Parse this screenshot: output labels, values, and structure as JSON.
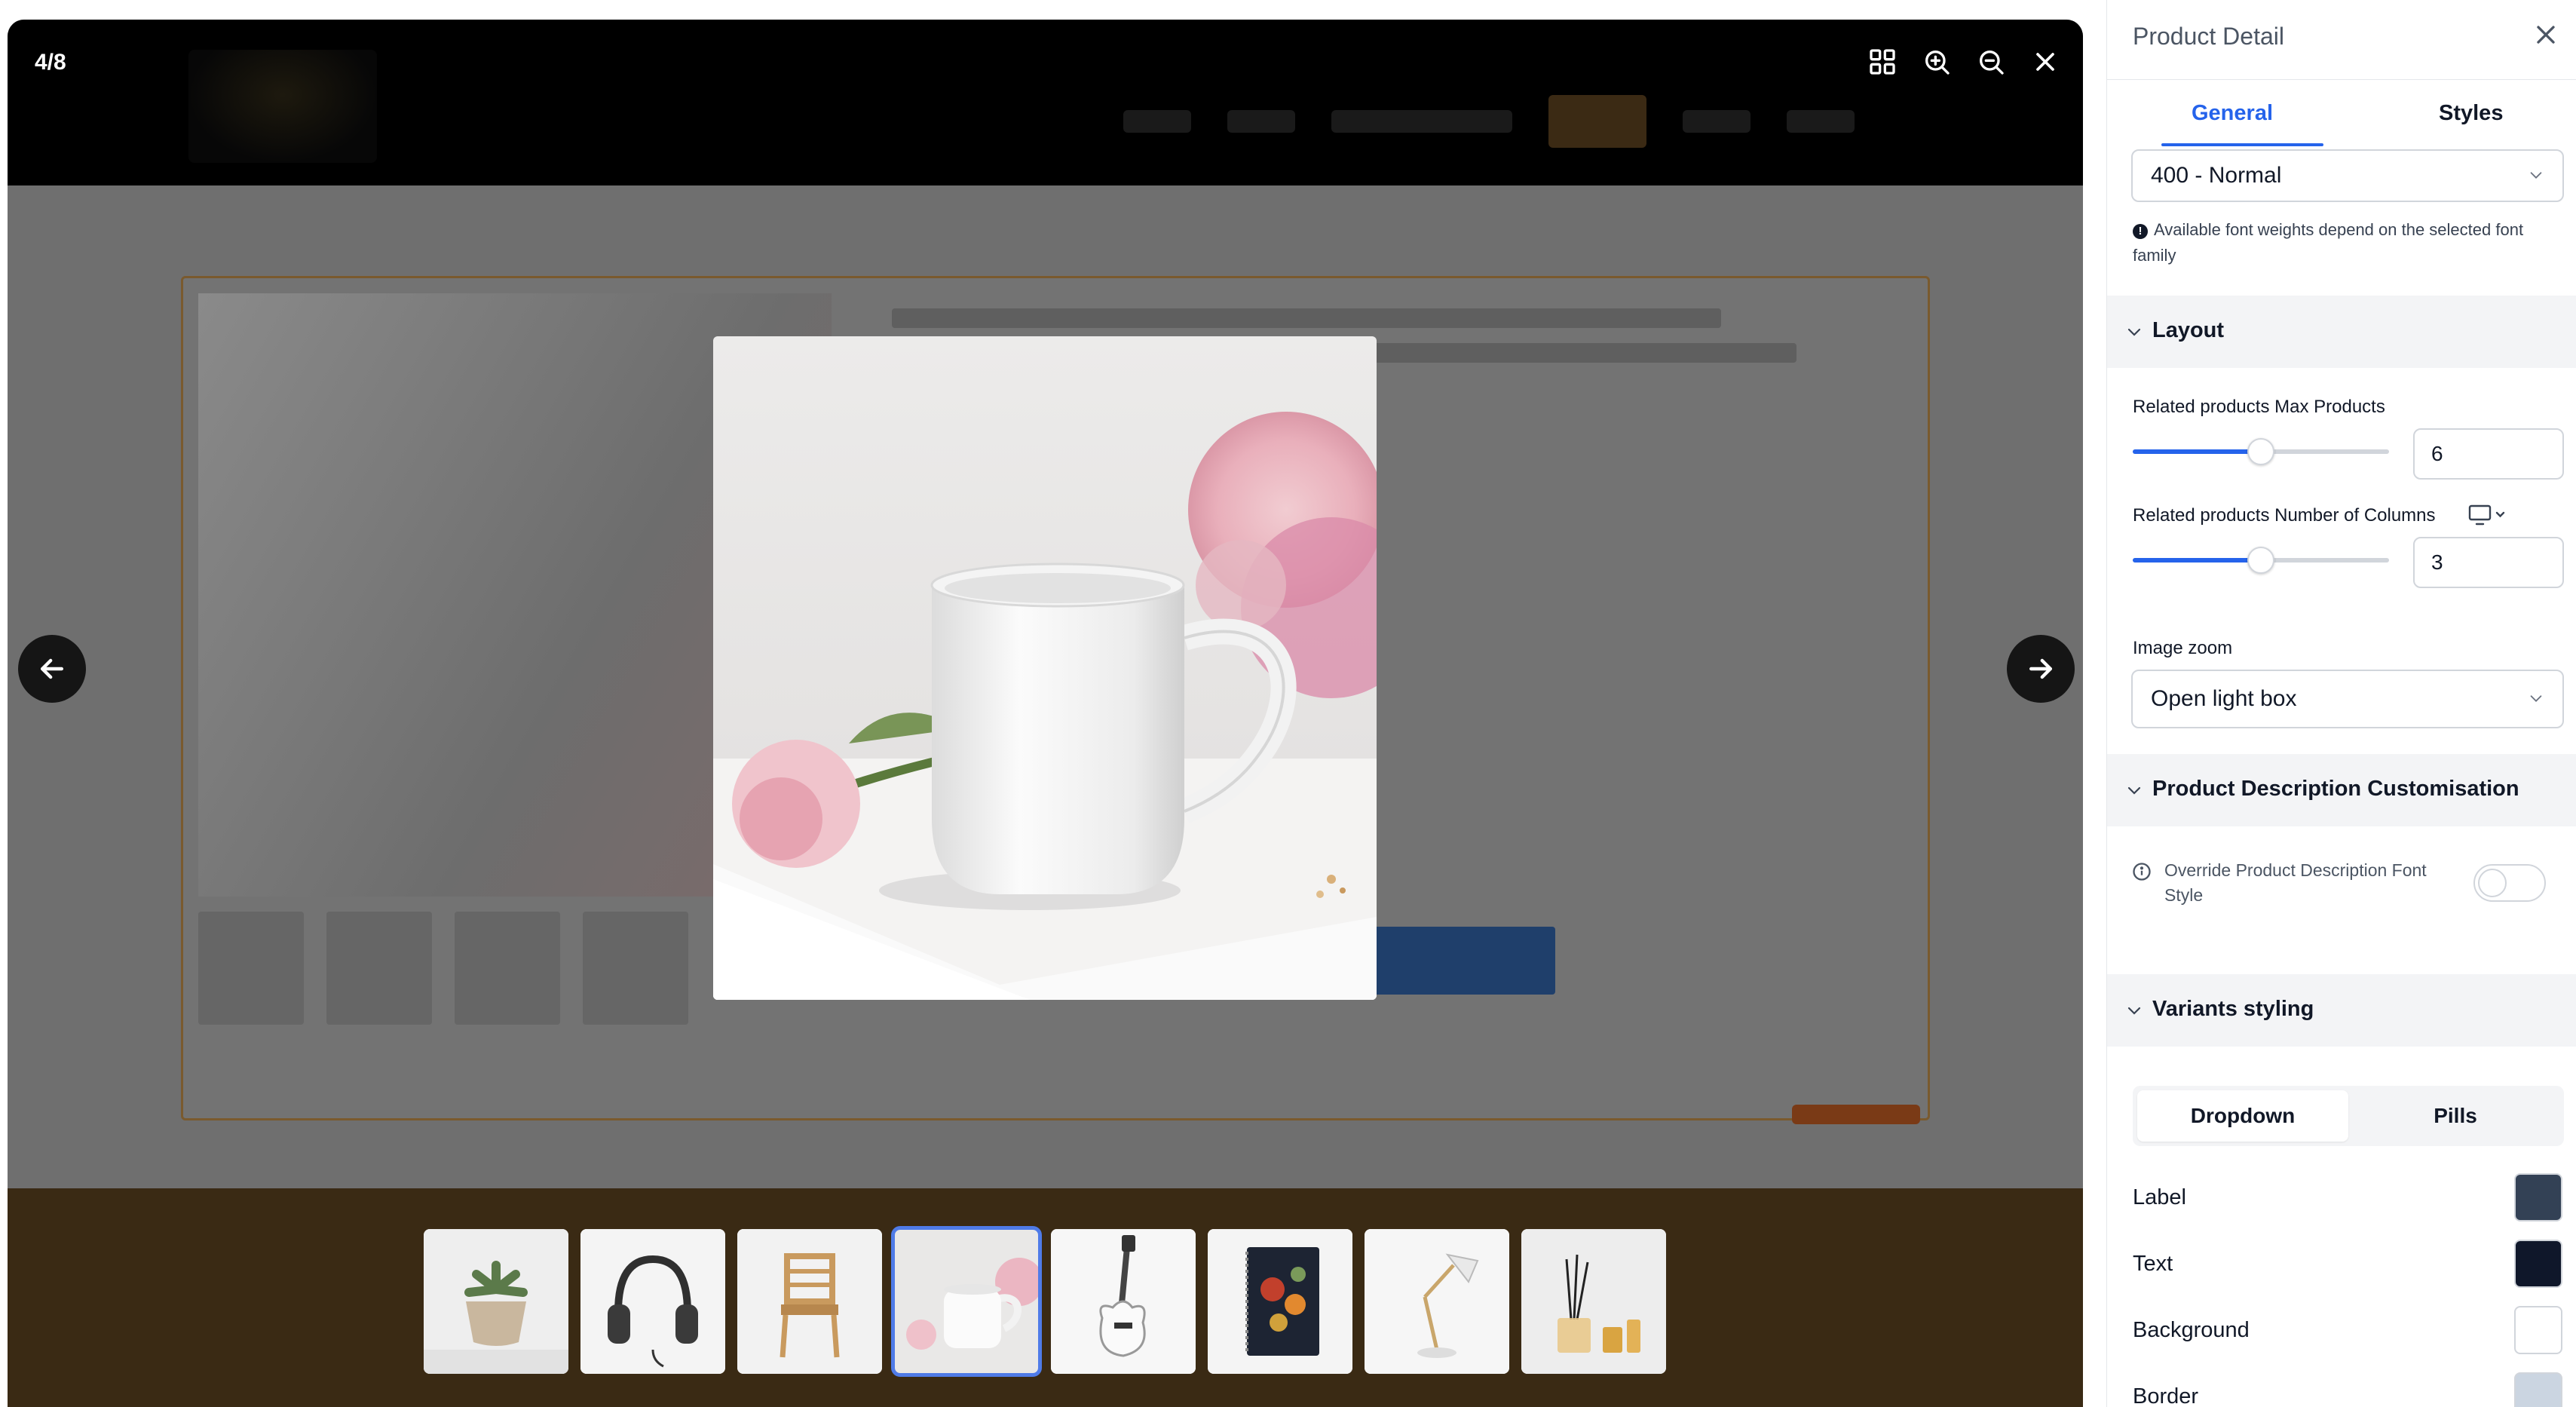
{
  "lightbox": {
    "counter": "4/8",
    "tools": [
      "grid-view-icon",
      "zoom-in-icon",
      "zoom-out-icon",
      "close-icon"
    ],
    "thumbnails": [
      {
        "name": "succulent-pot"
      },
      {
        "name": "headphones"
      },
      {
        "name": "wooden-chair"
      },
      {
        "name": "white-mug",
        "active": true
      },
      {
        "name": "electric-guitar"
      },
      {
        "name": "floral-notebook"
      },
      {
        "name": "desk-lamp"
      },
      {
        "name": "reed-diffuser"
      }
    ]
  },
  "panel": {
    "title": "Product Detail",
    "tabs": {
      "general": "General",
      "styles": "Styles"
    },
    "font_weight": {
      "value": "400 - Normal",
      "hint": "Available font weights depend on the selected font family"
    },
    "layout": {
      "heading": "Layout",
      "max_products": {
        "label": "Related products Max Products",
        "value": "6",
        "level": 0.5
      },
      "columns": {
        "label": "Related products Number of Columns",
        "value": "3",
        "level": 0.5
      },
      "image_zoom": {
        "label": "Image zoom",
        "value": "Open light box"
      }
    },
    "description": {
      "heading": "Product Description Customisation",
      "override_label": "Override Product Description Font Style",
      "override_on": false
    },
    "variants": {
      "heading": "Variants styling",
      "options": {
        "dropdown": "Dropdown",
        "pills": "Pills"
      },
      "selected": "Dropdown",
      "colors": [
        {
          "label": "Label",
          "color": "#334155"
        },
        {
          "label": "Text",
          "color": "#0f172a"
        },
        {
          "label": "Background",
          "color": "#ffffff"
        },
        {
          "label": "Border",
          "color": "#cbd5e1"
        }
      ]
    }
  }
}
